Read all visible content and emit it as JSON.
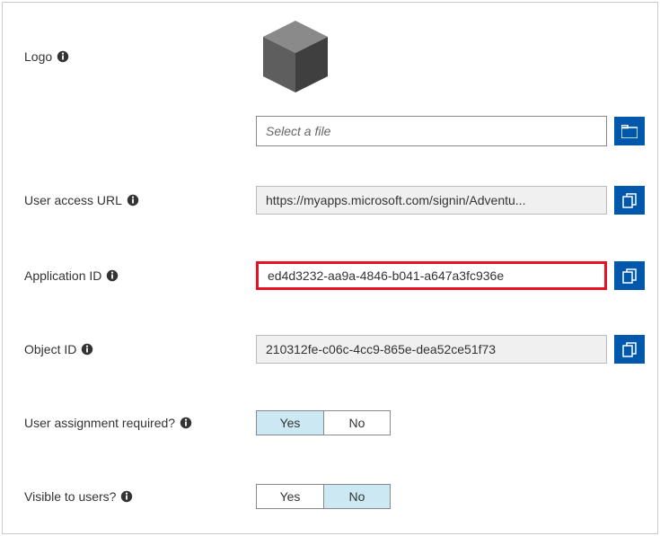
{
  "labels": {
    "logo": "Logo",
    "file_placeholder": "Select a file",
    "user_access_url": "User access URL",
    "application_id": "Application ID",
    "object_id": "Object ID",
    "user_assignment_required": "User assignment required?",
    "visible_to_users": "Visible to users?"
  },
  "values": {
    "user_access_url": "https://myapps.microsoft.com/signin/Adventu...",
    "application_id": "ed4d3232-aa9a-4846-b041-a647a3fc936e",
    "object_id": "210312fe-c06c-4cc9-865e-dea52ce51f73"
  },
  "toggles": {
    "yes": "Yes",
    "no": "No",
    "user_assignment_required_selected": "Yes",
    "visible_to_users_selected": "No"
  },
  "colors": {
    "accent": "#0058ad",
    "highlight_border": "#e81123",
    "toggle_active": "#cce9f3"
  }
}
